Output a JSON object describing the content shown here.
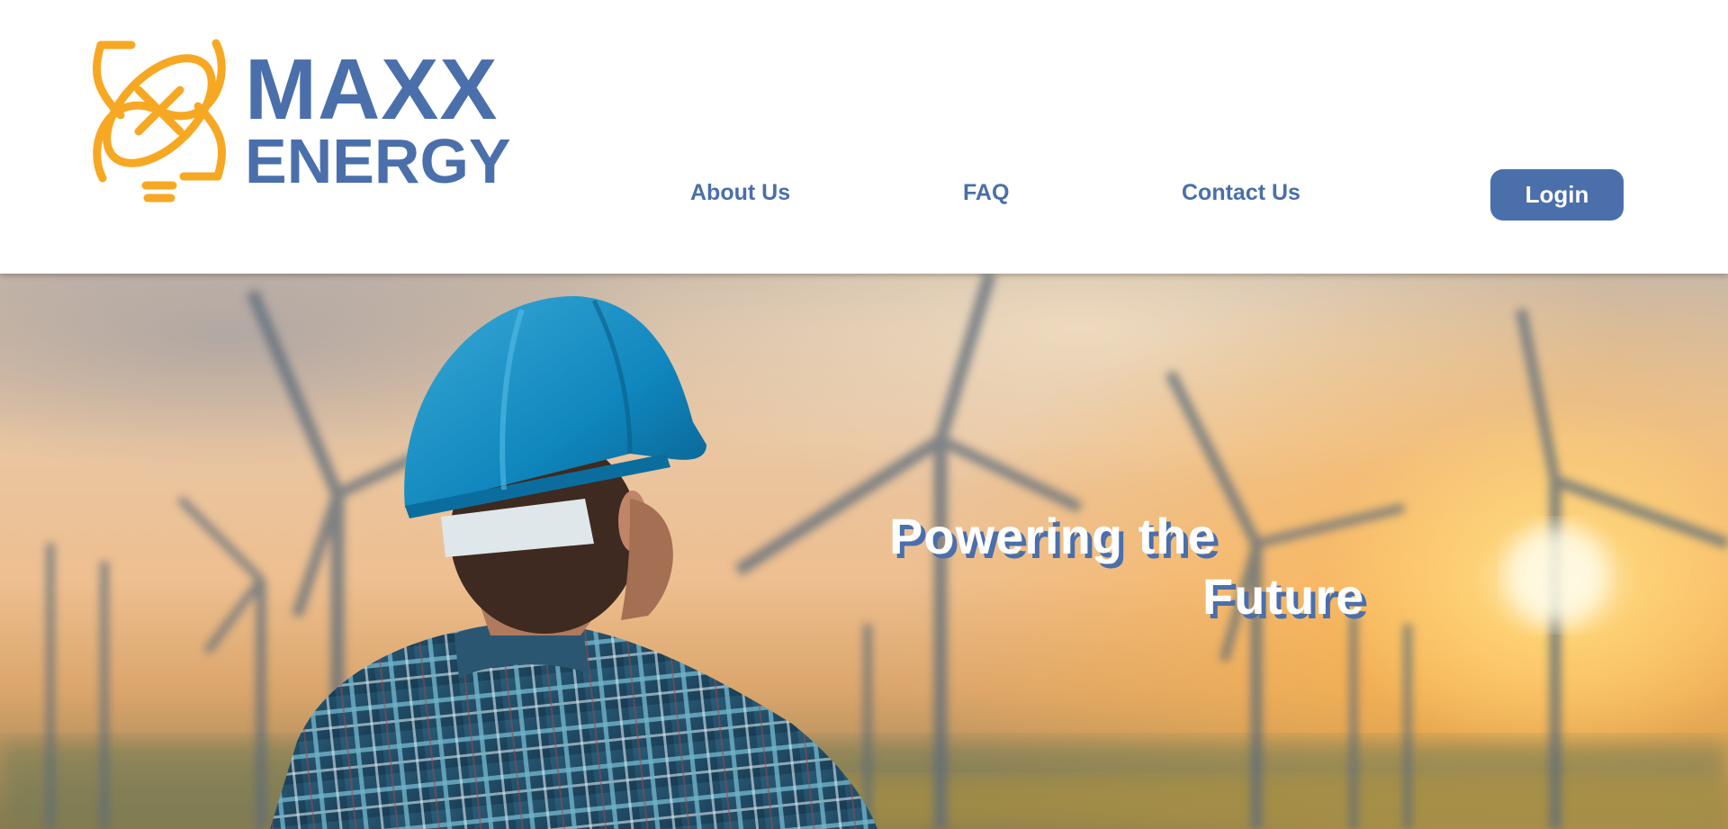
{
  "brand": {
    "name_line1": "MAXX",
    "name_line2": "ENERGY",
    "logo_icon": "atom-bulb-icon",
    "primary_color": "#4a6fab",
    "accent_color": "#f7a823"
  },
  "nav": {
    "about": "About Us",
    "faq": "FAQ",
    "contact": "Contact Us",
    "login": "Login"
  },
  "hero": {
    "headline_line1": "Powering the",
    "headline_line2": "Future",
    "image_subject": "worker-in-hard-hat-wind-turbines-sunset"
  }
}
